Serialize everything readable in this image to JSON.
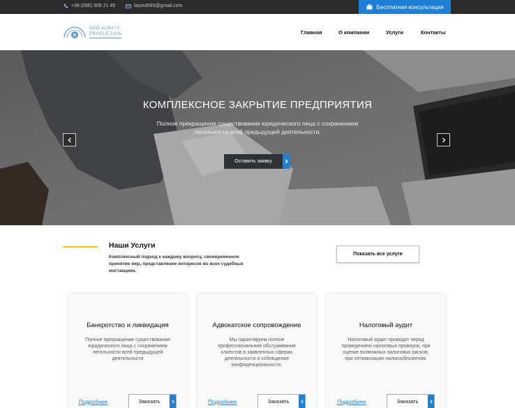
{
  "topbar": {
    "phone": "+38 (096) 309 21 45",
    "email": "layout585@gmail.com",
    "consult_label": "Бесплатная консультация",
    "colors": {
      "background": "#2b2b2b",
      "accent": "#1d7fd6"
    }
  },
  "logo": {
    "line1": "GEO ALMATY",
    "line2": "PRODUCTION"
  },
  "nav": {
    "items": [
      {
        "label": "Главная"
      },
      {
        "label": "О компании"
      },
      {
        "label": "Услуги"
      },
      {
        "label": "Контакты"
      }
    ]
  },
  "hero": {
    "title": "КОМПЛЕКСНОЕ ЗАКРЫТИЕ ПРЕДПРИЯТИЯ",
    "subtitle": "Полное прекращение существования юридического лица с сохранением легальности всей предыдущей деятельности.",
    "button_label": "Оставить заявку",
    "prev_icon": "chevron-left-icon",
    "next_icon": "chevron-right-icon"
  },
  "services": {
    "title": "Наши Услуги",
    "description": "Комплексный подход к каждому вопросу, своевременное принятие мер, представление интересов во всех судебных инстанциях.",
    "all_button_label": "Показать все услуги",
    "cards": [
      {
        "title": "Банкротство и ликвидация",
        "text": "Полное прекращение существования юридического лица с сохранением легальности всей предыдущей деятельности",
        "more_label": "Подробнее",
        "order_label": "Заказать"
      },
      {
        "title": "Адвокатское сопровождение",
        "text": "Мы гарантируем полное профессиональное обслуживание клиентов в заявленных сферах деятельности и соблюдение конфиденциальности.",
        "more_label": "Подробнее",
        "order_label": "Заказать"
      },
      {
        "title": "Налоговый аудит",
        "text": "Налоговый аудит проводят перед проведением налоговых проверок, при оценке возможных налоговых рисков, при оптимизации налогообложения.",
        "more_label": "Подробнее",
        "order_label": "Заказать"
      }
    ]
  }
}
